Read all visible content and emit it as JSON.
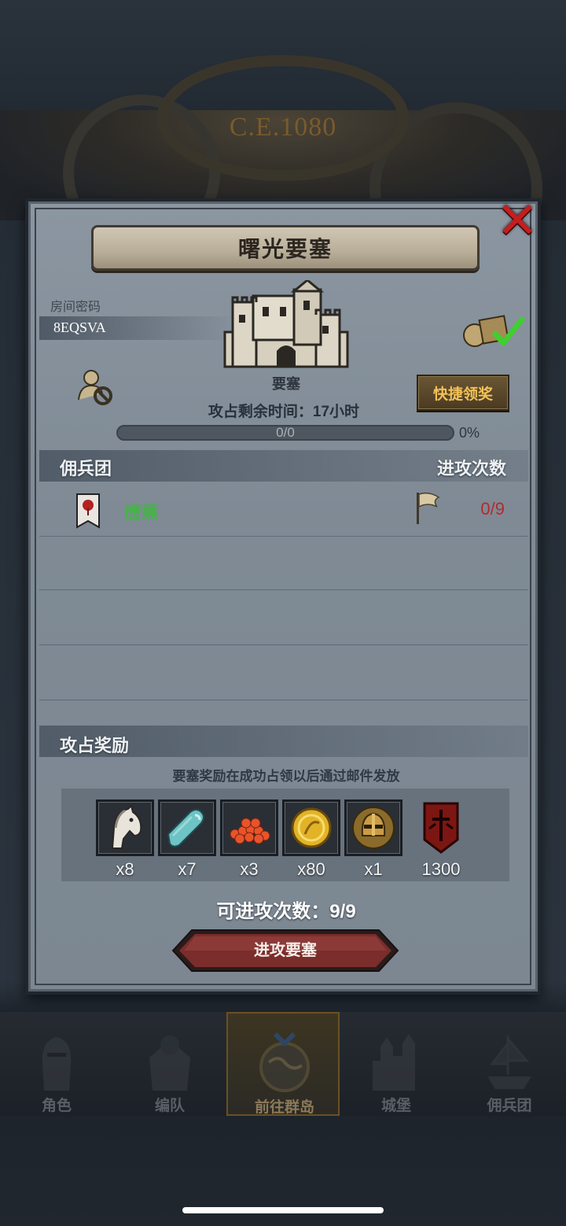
{
  "backdrop": {
    "era": "C.E.1080"
  },
  "dialog": {
    "title": "曙光要塞",
    "room_label": "房间密码",
    "room_code": "8EQSVA",
    "fortress_label": "要塞",
    "quick_claim": "快捷领奖",
    "remaining_time": "攻占剩余时间：17小时",
    "progress": {
      "text": "0/0",
      "percent_label": "0%",
      "fraction": 0
    },
    "mercenary_section": {
      "title": "佣兵团",
      "right": "进攻次数"
    },
    "mercenaries": [
      {
        "name": "唐蒹",
        "attacks": "0/9"
      }
    ],
    "rewards_section": {
      "title": "攻占奖励",
      "note": "要塞奖励在成功占领以后通过邮件发放"
    },
    "rewards": [
      {
        "icon": "horse-icon",
        "qty": "x8"
      },
      {
        "icon": "cloth-icon",
        "qty": "x7"
      },
      {
        "icon": "roe-icon",
        "qty": "x3"
      },
      {
        "icon": "gold-coin-icon",
        "qty": "x80"
      },
      {
        "icon": "helmet-icon",
        "qty": "x1"
      },
      {
        "icon": "sword-banner-icon",
        "qty": "1300"
      }
    ],
    "attack_remaining": "可进攻次数：9/9",
    "attack_button": "进攻要塞"
  },
  "nav": {
    "items": [
      {
        "label": "角色",
        "icon": "knight-icon"
      },
      {
        "label": "编队",
        "icon": "armor-icon"
      },
      {
        "label": "前往群岛",
        "icon": "globe-icon"
      },
      {
        "label": "城堡",
        "icon": "castle-icon"
      },
      {
        "label": "佣兵团",
        "icon": "ship-icon"
      }
    ],
    "active_index": 2
  },
  "colors": {
    "accent_gold": "#f2c257",
    "merc_name": "#47b24a",
    "attack_count": "#b32a2a",
    "close": "#c41e1e"
  }
}
